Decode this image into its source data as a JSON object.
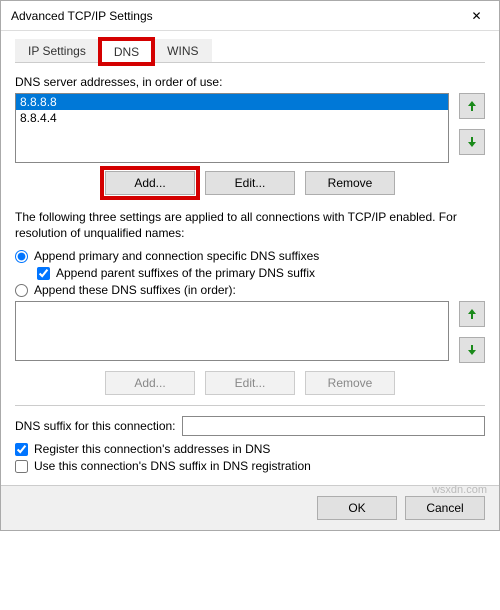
{
  "window": {
    "title": "Advanced TCP/IP Settings"
  },
  "tabs": {
    "ip_settings": "IP Settings",
    "dns": "DNS",
    "wins": "WINS"
  },
  "dns_servers": {
    "label": "DNS server addresses, in order of use:",
    "items": [
      "8.8.8.8",
      "8.8.4.4"
    ],
    "selected_index": 0
  },
  "buttons": {
    "add": "Add...",
    "edit": "Edit...",
    "remove": "Remove",
    "ok": "OK",
    "cancel": "Cancel"
  },
  "info": {
    "text": "The following three settings are applied to all connections with TCP/IP enabled. For resolution of unqualified names:"
  },
  "radios": {
    "append_primary": "Append primary and connection specific DNS suffixes",
    "append_parent": "Append parent suffixes of the primary DNS suffix",
    "append_these": "Append these DNS suffixes (in order):"
  },
  "suffix_conn": {
    "label": "DNS suffix for this connection:",
    "value": ""
  },
  "checks": {
    "register": "Register this connection's addresses in DNS",
    "use_suffix": "Use this connection's DNS suffix in DNS registration"
  },
  "watermark": "wsxdn.com"
}
